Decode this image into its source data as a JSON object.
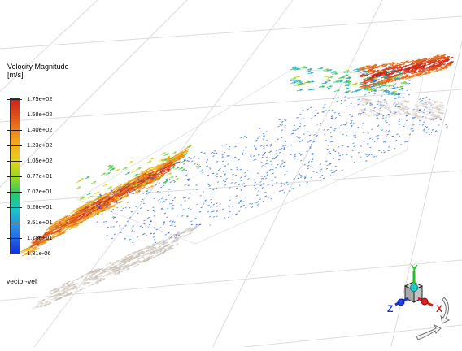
{
  "legend": {
    "title": "Velocity Magnitude",
    "units": "[m/s]",
    "ticks": [
      "1.75e+02",
      "1.58e+02",
      "1.40e+02",
      "1.23e+02",
      "1.05e+02",
      "8.77e+01",
      "7.02e+01",
      "5.26e+01",
      "3.51e+01",
      "1.75e+01",
      "1.31e-06"
    ]
  },
  "vector_object_name": "vector-vel",
  "triad": {
    "x_label": "X",
    "y_label": "Y",
    "z_label": "Z"
  },
  "colors": {
    "background": "#ffffff",
    "grid": "#dcdcdc",
    "colormap_high": "#c8201a",
    "colormap_mid": "#25c86a",
    "colormap_low": "#1530d8",
    "axis_x": "#d02020",
    "axis_y": "#20c020",
    "axis_z": "#2030d0"
  },
  "icons": {
    "triad": "orientation-triad-icon",
    "rotate_right": "rotate-cw-icon",
    "rotate_bottom": "rotate-ccw-icon"
  }
}
